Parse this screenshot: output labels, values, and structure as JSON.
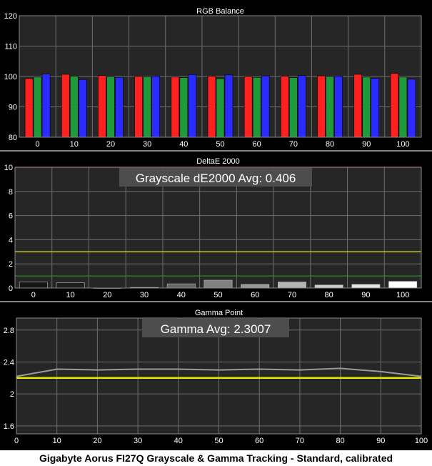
{
  "caption": "Gigabyte Aorus FI27Q Grayscale & Gamma Tracking - Standard, calibrated",
  "colors": {
    "background": "#000000",
    "plot_bg": "#262626",
    "grid": "#6e6e6e",
    "text": "#ffffff",
    "red": "#ff2020",
    "green": "#1e9a3a",
    "blue": "#2b2bff",
    "limit_high": "#ff2a2a",
    "limit_mid": "#d8d820",
    "limit_low": "#2a8a2a",
    "gamma_line": "#9a9a9a",
    "gamma_target": "#e6e600"
  },
  "chart_data": [
    {
      "type": "bar",
      "title": "RGB Balance",
      "categories": [
        "0",
        "10",
        "20",
        "30",
        "40",
        "50",
        "60",
        "70",
        "80",
        "90",
        "100"
      ],
      "series": [
        {
          "color_key": "red",
          "values": [
            99.3,
            100.7,
            100.3,
            100.0,
            99.8,
            100.1,
            99.9,
            100.1,
            100.2,
            100.7,
            101.0
          ]
        },
        {
          "color_key": "green",
          "values": [
            99.8,
            100.1,
            99.9,
            99.9,
            99.6,
            99.3,
            99.7,
            99.6,
            99.9,
            99.8,
            99.8
          ]
        },
        {
          "color_key": "blue",
          "values": [
            100.8,
            99.0,
            99.7,
            100.1,
            100.6,
            100.5,
            100.2,
            100.3,
            100.1,
            99.4,
            99.1
          ]
        }
      ],
      "yticks": [
        "80",
        "90",
        "100",
        "110",
        "120"
      ],
      "ylim": [
        80,
        120
      ]
    },
    {
      "type": "bar",
      "title": "DeltaE 2000",
      "annotation": "Grayscale dE2000 Avg: 0.406",
      "categories": [
        "0",
        "10",
        "20",
        "30",
        "40",
        "50",
        "60",
        "70",
        "80",
        "90",
        "100"
      ],
      "values": [
        0.5,
        0.45,
        0.0,
        0.05,
        0.35,
        0.65,
        0.3,
        0.5,
        0.25,
        0.3,
        0.55
      ],
      "bar_colors": [
        "#151515",
        "#1e1e1e",
        "#333333",
        "#4c4c4c",
        "#666666",
        "#808080",
        "#999999",
        "#b3b3b3",
        "#cccccc",
        "#e6e6e6",
        "#ffffff"
      ],
      "reference_lines": [
        {
          "value": 10,
          "color_key": "limit_high"
        },
        {
          "value": 3,
          "color_key": "limit_mid"
        },
        {
          "value": 1,
          "color_key": "limit_low"
        }
      ],
      "yticks": [
        "0",
        "2",
        "4",
        "6",
        "8",
        "10"
      ],
      "ylim": [
        0,
        10
      ]
    },
    {
      "type": "line",
      "title": "Gamma Point",
      "annotation": "Gamma Avg: 2.3007",
      "x": [
        0,
        10,
        20,
        30,
        40,
        50,
        60,
        70,
        80,
        90,
        100
      ],
      "values": [
        2.22,
        2.31,
        2.3,
        2.31,
        2.31,
        2.3,
        2.31,
        2.3,
        2.32,
        2.28,
        2.22
      ],
      "target": 2.2,
      "xticks": [
        "0",
        "10",
        "20",
        "30",
        "40",
        "50",
        "60",
        "70",
        "80",
        "90",
        "100"
      ],
      "yticks": [
        "1.6",
        "2",
        "2.4",
        "2.8"
      ],
      "xlim": [
        0,
        100
      ],
      "ylim": [
        1.5,
        2.95
      ]
    }
  ]
}
